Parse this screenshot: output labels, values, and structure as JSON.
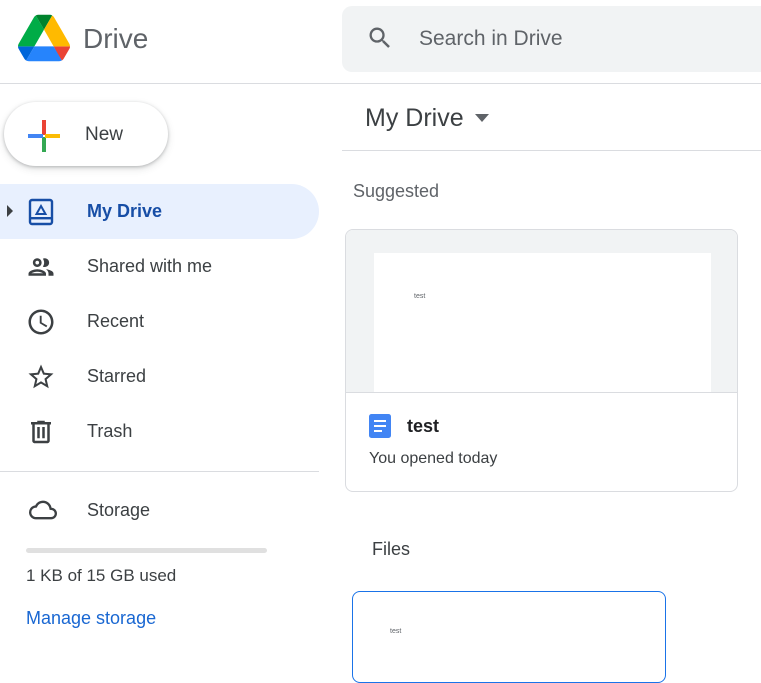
{
  "header": {
    "app_title": "Drive",
    "logo_icon": "google-drive-logo",
    "search": {
      "placeholder": "Search in Drive",
      "value": "",
      "icon": "search-icon"
    }
  },
  "sidebar": {
    "new_button": {
      "label": "New",
      "icon": "plus-icon"
    },
    "items": [
      {
        "label": "My Drive",
        "icon": "my-drive-icon",
        "active": true
      },
      {
        "label": "Shared with me",
        "icon": "people-icon",
        "active": false
      },
      {
        "label": "Recent",
        "icon": "clock-icon",
        "active": false
      },
      {
        "label": "Starred",
        "icon": "star-icon",
        "active": false
      },
      {
        "label": "Trash",
        "icon": "trash-icon",
        "active": false
      }
    ],
    "storage": {
      "label": "Storage",
      "icon": "cloud-icon",
      "used_text": "1 KB of 15 GB used",
      "used_fraction": 0.0,
      "manage_link": "Manage storage"
    }
  },
  "main": {
    "location_title": "My Drive",
    "suggested": {
      "heading": "Suggested",
      "cards": [
        {
          "name": "test",
          "reason": "You opened today",
          "thumbnail_text": "test",
          "icon": "google-docs-icon"
        }
      ]
    },
    "files": {
      "heading": "Files",
      "cards": [
        {
          "thumbnail_text": "test"
        }
      ]
    }
  },
  "colors": {
    "accent_blue": "#1a73e8",
    "active_nav_bg": "#e8f0fe",
    "active_nav_text": "#174ea6",
    "link_blue": "#1967d2",
    "docs_blue": "#4285f4"
  }
}
